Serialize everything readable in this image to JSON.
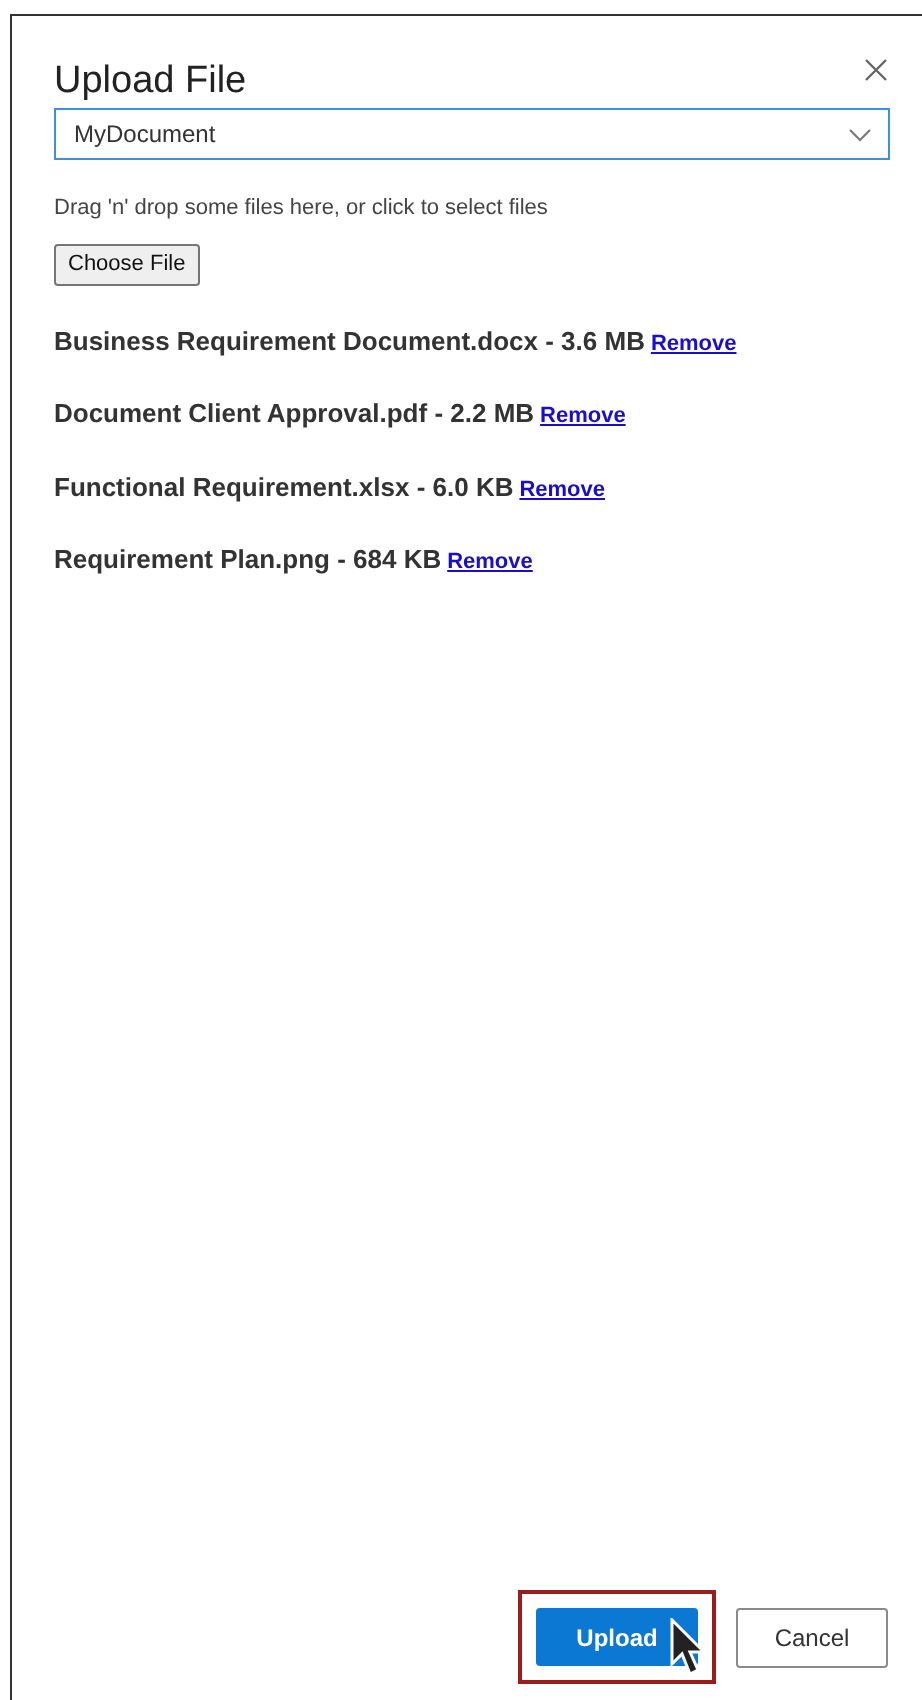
{
  "dialog": {
    "title": "Upload File"
  },
  "dropdown": {
    "value": "MyDocument"
  },
  "hint": "Drag 'n' drop some files here, or click to select files",
  "choose_button": "Choose File",
  "files": [
    {
      "label": "Business Requirement Document.docx - 3.6 MB",
      "action": "Remove"
    },
    {
      "label": "Document Client Approval.pdf - 2.2 MB",
      "action": "Remove"
    },
    {
      "label": "Functional Requirement.xlsx - 6.0 KB",
      "action": "Remove"
    },
    {
      "label": "Requirement Plan.png - 684 KB",
      "action": "Remove"
    }
  ],
  "footer": {
    "primary": {
      "label": "Upload",
      "highlighted": true
    },
    "secondary": "Cancel"
  }
}
